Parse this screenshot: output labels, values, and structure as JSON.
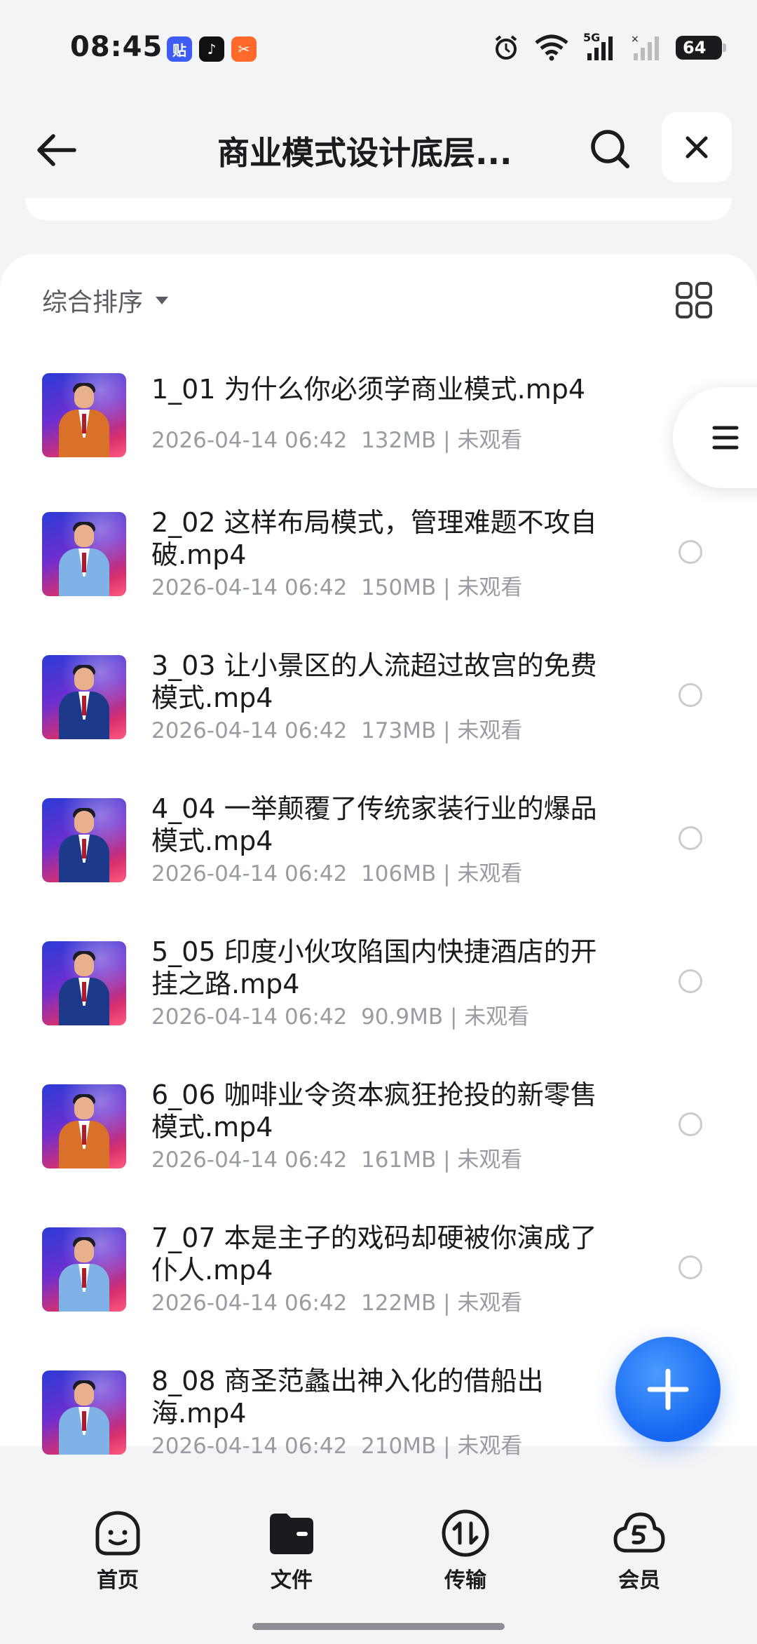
{
  "status_bar": {
    "time": "08:45",
    "app_icons": [
      {
        "name": "tieba-icon",
        "glyph": "贴",
        "color": "#3e5bf6"
      },
      {
        "name": "douyin-icon",
        "glyph": "♪",
        "color": "#111111"
      },
      {
        "name": "orange-app-icon",
        "glyph": "✂",
        "color": "#ff6a2b"
      }
    ],
    "network_label": "5G",
    "battery": "64"
  },
  "header": {
    "title": "商业模式设计底层..."
  },
  "sort": {
    "label": "综合排序"
  },
  "files": [
    {
      "name": "1_01 为什么你必须学商业模式.mp4",
      "date": "2026-04-14 06:42",
      "size": "132MB",
      "status": "未观看",
      "suit": "#d9712a"
    },
    {
      "name": "2_02 这样布局模式，管理难题不攻自破.mp4",
      "date": "2026-04-14 06:42",
      "size": "150MB",
      "status": "未观看",
      "suit": "#7fb3e8"
    },
    {
      "name": "3_03 让小景区的人流超过故宫的免费模式.mp4",
      "date": "2026-04-14 06:42",
      "size": "173MB",
      "status": "未观看",
      "suit": "#1d3a8a"
    },
    {
      "name": "4_04 一举颠覆了传统家装行业的爆品模式.mp4",
      "date": "2026-04-14 06:42",
      "size": "106MB",
      "status": "未观看",
      "suit": "#1d3a8a"
    },
    {
      "name": "5_05 印度小伙攻陷国内快捷酒店的开挂之路.mp4",
      "date": "2026-04-14 06:42",
      "size": "90.9MB",
      "status": "未观看",
      "suit": "#1d3a8a"
    },
    {
      "name": "6_06 咖啡业令资本疯狂抢投的新零售模式.mp4",
      "date": "2026-04-14 06:42",
      "size": "161MB",
      "status": "未观看",
      "suit": "#d9712a"
    },
    {
      "name": "7_07 本是主子的戏码却硬被你演成了仆人.mp4",
      "date": "2026-04-14 06:42",
      "size": "122MB",
      "status": "未观看",
      "suit": "#7fb3e8"
    },
    {
      "name": "8_08 商圣范蠡出神入化的借船出海.mp4",
      "date": "2026-04-14 06:42",
      "size": "210MB",
      "status": "未观看",
      "suit": "#7fb3e8"
    }
  ],
  "bottom_nav": [
    {
      "label": "首页",
      "icon": "home-face-icon"
    },
    {
      "label": "文件",
      "icon": "folder-icon"
    },
    {
      "label": "传输",
      "icon": "transfer-icon"
    },
    {
      "label": "会员",
      "icon": "vip-cloud-icon"
    }
  ],
  "colors": {
    "accent": "#1565f0",
    "background": "#f3f4f6",
    "meta_text": "#9a9ca3"
  }
}
